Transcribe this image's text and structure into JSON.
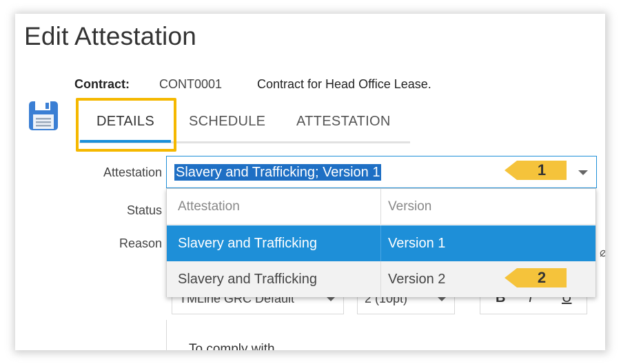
{
  "page": {
    "title": "Edit Attestation"
  },
  "contract": {
    "label": "Contract:",
    "id": "CONT0001",
    "description": "Contract for Head Office Lease."
  },
  "tabs": [
    {
      "label": "DETAILS",
      "active": true
    },
    {
      "label": "SCHEDULE",
      "active": false
    },
    {
      "label": "ATTESTATION",
      "active": false
    }
  ],
  "fields": {
    "attestation_label": "Attestation",
    "status_label": "Status",
    "reason_label": "Reason",
    "attestation_value": "Slavery and Trafficking; Version 1"
  },
  "dropdown": {
    "headers": [
      "Attestation",
      "Version"
    ],
    "rows": [
      {
        "attestation": "Slavery and Trafficking",
        "version": "Version 1",
        "selected": true
      },
      {
        "attestation": "Slavery and Trafficking",
        "version": "Version 2",
        "selected": false
      }
    ]
  },
  "editor": {
    "font": "TMLine GRC Default",
    "size": "2 (10pt)",
    "bold": "B",
    "italic": "I",
    "underline": "U",
    "body_text": "To comply with"
  },
  "callouts": [
    "1",
    "2"
  ],
  "icons": {
    "save": "save-icon",
    "dropdown_arrow": "chevron-down-icon"
  },
  "colors": {
    "accent": "#1e8fd8",
    "highlight": "#f5b800",
    "callout": "#f5c33b",
    "selection": "#1e6fc4"
  }
}
